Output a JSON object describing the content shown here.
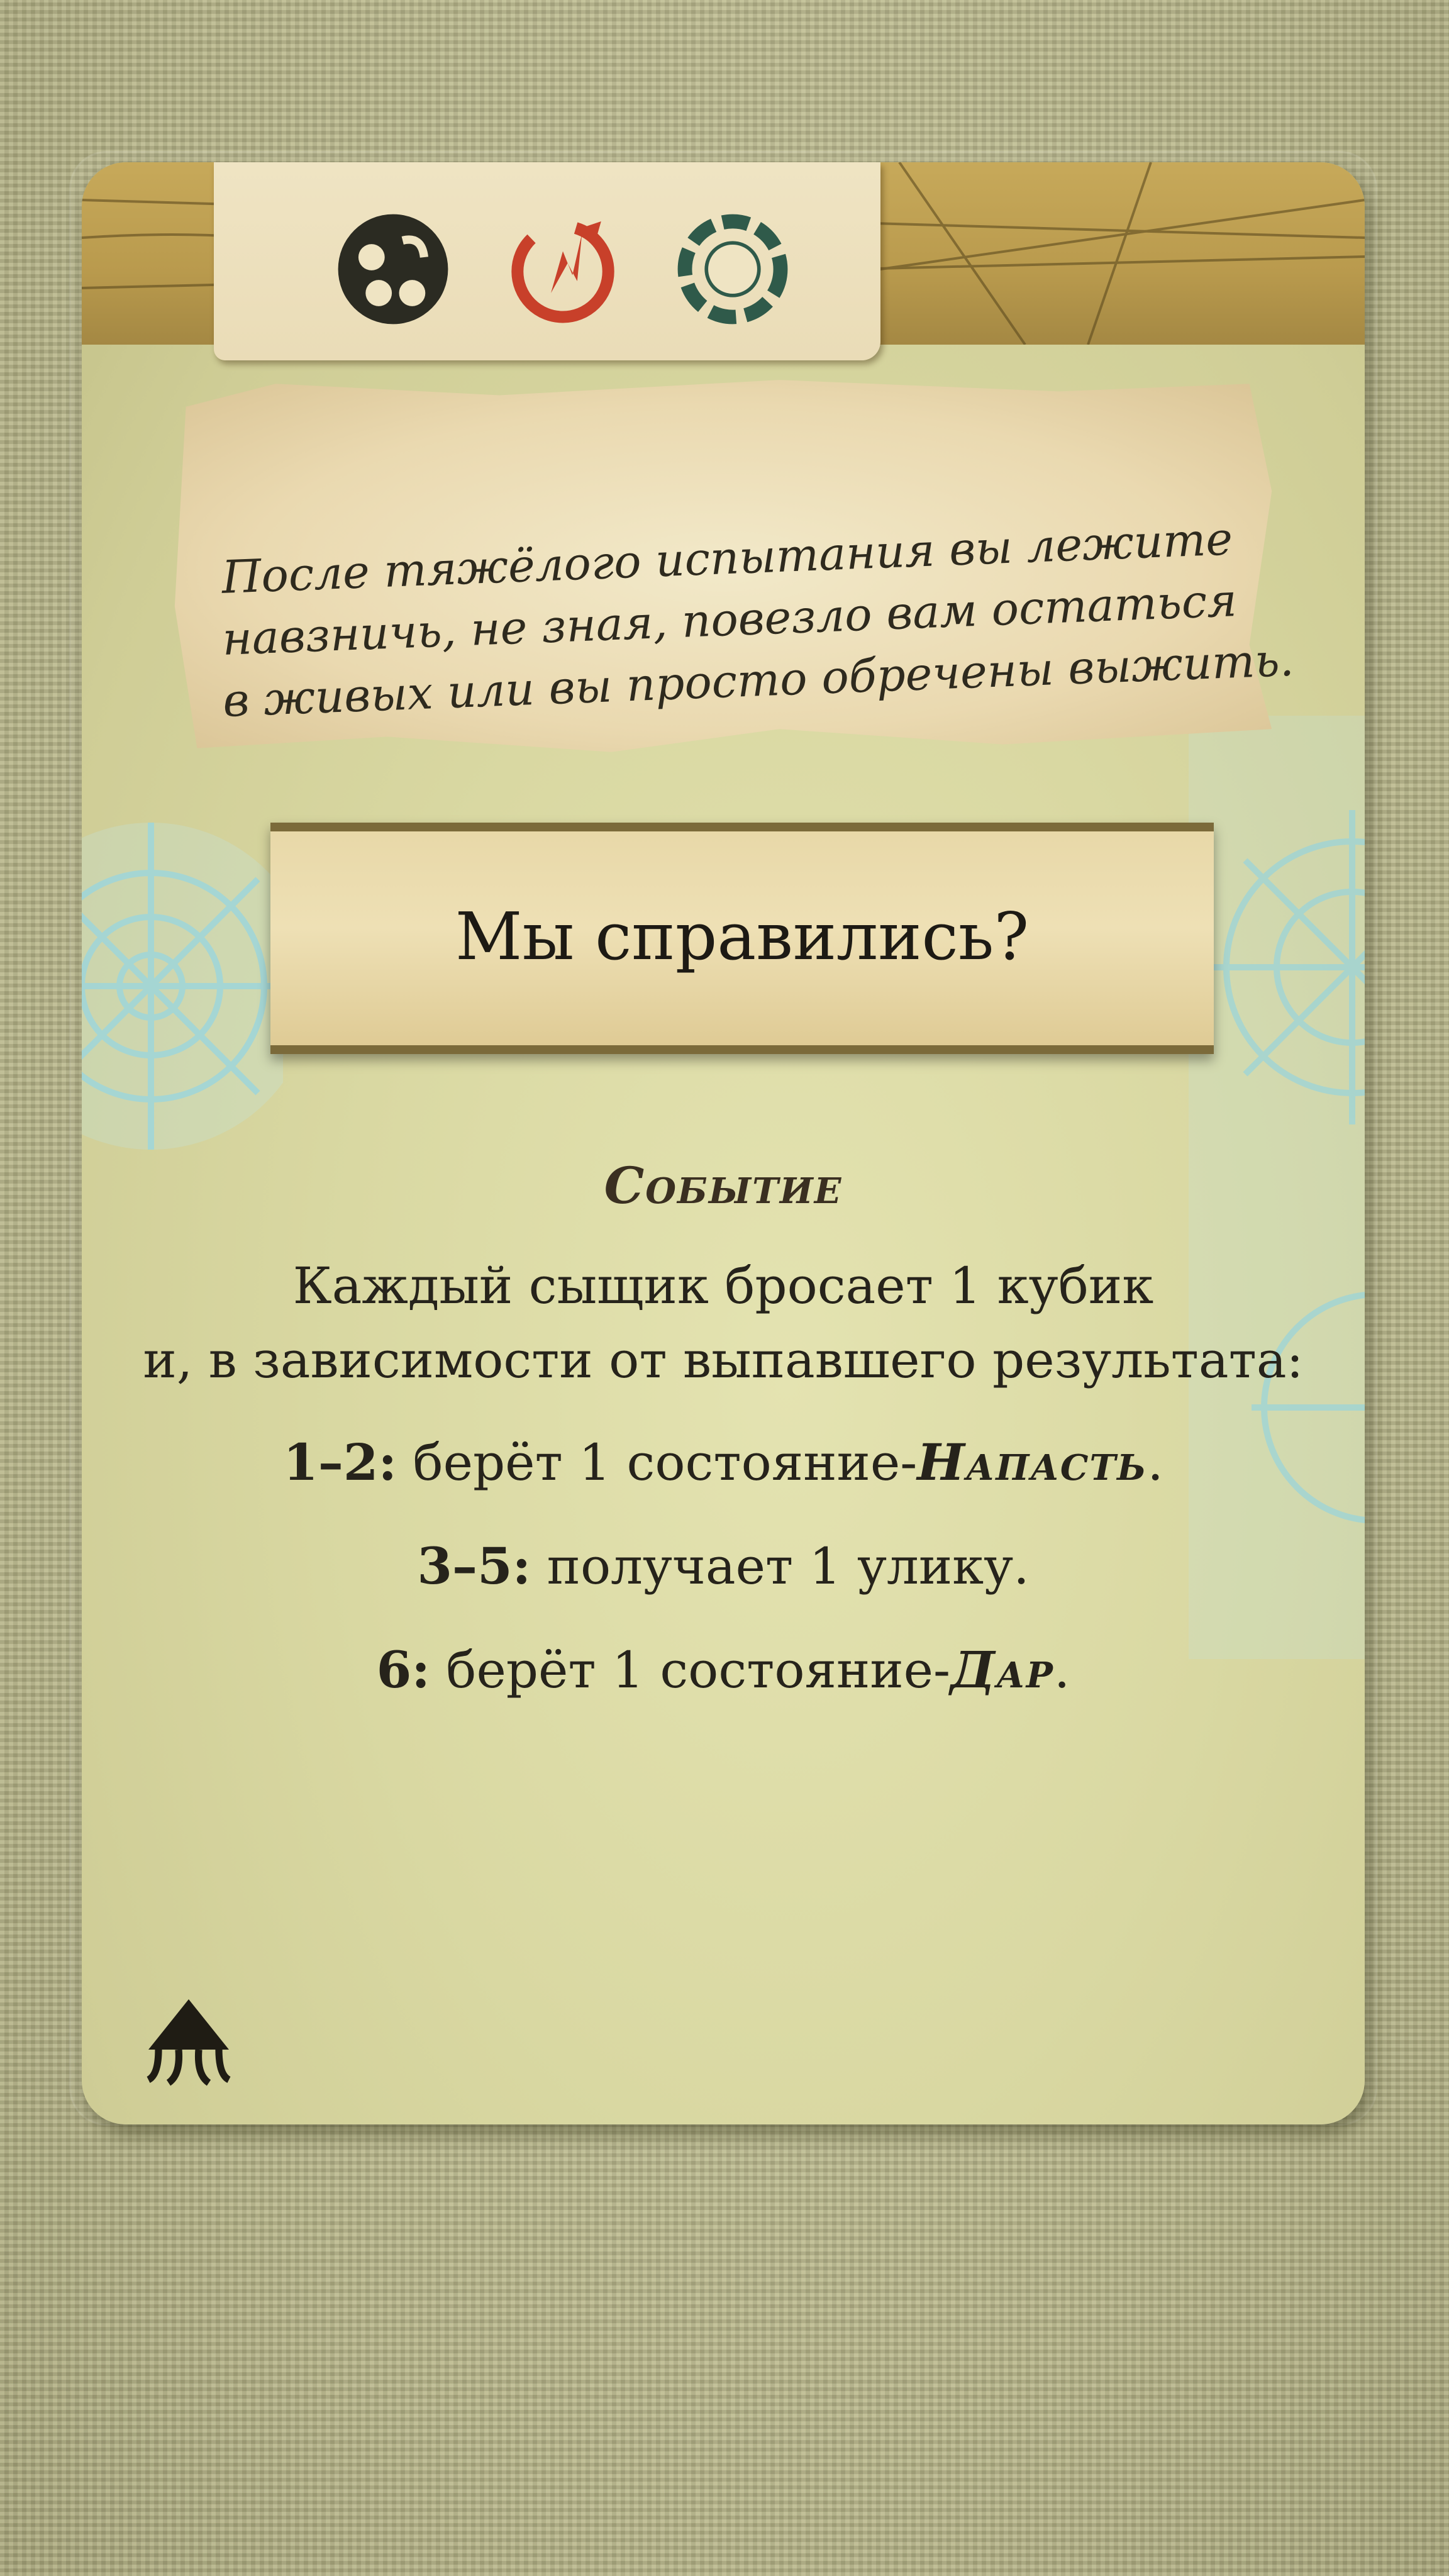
{
  "card": {
    "flavor_lines": [
      "После тяжёлого испытания вы лежите",
      "навзничь, не зная, повезло вам остаться",
      "в живых или вы просто обречены выжить."
    ],
    "title": "Мы справились?",
    "type": "Событие",
    "rules": {
      "line1": "Каждый сыщик бросает 1 кубик",
      "line2": "и, в зависимости от выпавшего результата:",
      "r1_range": "1–2:",
      "r1_text": " берёт 1 состояние-",
      "r1_keyword": "Напасть",
      "r1_end": ".",
      "r2_range": "3–5:",
      "r2_text": " получает 1 улику.",
      "r3_range": "6:",
      "r3_text": " берёт 1 состояние-",
      "r3_keyword": "Дар",
      "r3_end": "."
    },
    "icons": [
      "combat-icon",
      "will-icon",
      "lore-icon",
      "set-symbol-icon"
    ]
  },
  "colors": {
    "background": "#b9b88d",
    "card": "#dcdba6",
    "text": "#26231b",
    "frost": "#8fd0d8",
    "combat_icon": "#2b2b22",
    "will_icon": "#c8402a",
    "lore_icon": "#2f5a4a"
  }
}
